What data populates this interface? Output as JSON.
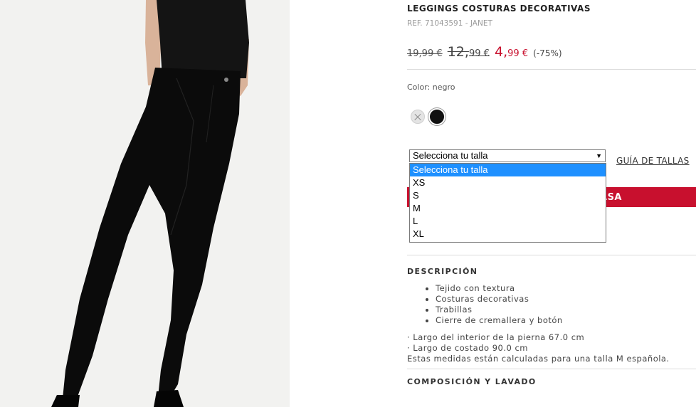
{
  "product": {
    "title": "LEGGINGS COSTURAS DECORATIVAS",
    "ref": "REF. 71043591 - JANET"
  },
  "price": {
    "original": "19,99 €",
    "previous_int": "12,",
    "previous_dec": "99 €",
    "current_int": "4,",
    "current_dec": "99 €",
    "discount": "(-75%)"
  },
  "color": {
    "label": "Color: negro",
    "swatches": [
      {
        "name": "gris",
        "hex": "#e4e4e4"
      },
      {
        "name": "negro",
        "hex": "#111111"
      }
    ]
  },
  "size_select": {
    "value": "Selecciona tu talla",
    "options": [
      "Selecciona tu talla",
      "XS",
      "S",
      "M",
      "L",
      "XL"
    ]
  },
  "size_guide": "GUÍA DE TALLAS",
  "add_button_visible": "LSA",
  "description": {
    "heading": "DESCRIPCIÓN",
    "features": [
      "Tejido con textura",
      "Costuras decorativas",
      "Trabillas",
      "Cierre de cremallera y botón"
    ],
    "measure_1": "· Largo del interior de la pierna 67.0 cm",
    "measure_2": "· Largo de costado 90.0 cm",
    "measure_note": "Estas medidas están calculadas para una talla M española."
  },
  "composition_heading": "COMPOSICIÓN Y LAVADO",
  "colors": {
    "accent": "#c8102e",
    "select_highlight": "#1e90ff"
  }
}
